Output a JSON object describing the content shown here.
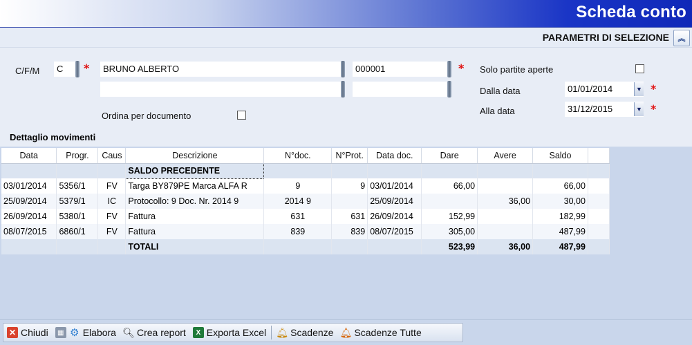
{
  "window": {
    "title": "Scheda conto"
  },
  "params": {
    "header_label": "PARAMETRI DI SELEZIONE",
    "cfm_label": "C/F/M",
    "cfm_value": "C",
    "name_value": "BRUNO ALBERTO",
    "name2_value": "",
    "code_value": "000001",
    "code2_value": "",
    "order_by_doc_label": "Ordina per documento",
    "open_only_label": "Solo partite aperte",
    "from_date_label": "Dalla data",
    "from_date_value": "01/01/2014",
    "to_date_label": "Alla data",
    "to_date_value": "31/12/2015",
    "required_mark": "*"
  },
  "section": {
    "title": "Dettaglio movimenti"
  },
  "grid": {
    "columns": [
      "Data",
      "Progr.",
      "Caus",
      "Descrizione",
      "N°doc.",
      "N°Prot.",
      "Data doc.",
      "Dare",
      "Avere",
      "Saldo"
    ],
    "saldo_precedente": "SALDO PRECEDENTE",
    "rows": [
      {
        "data": "03/01/2014",
        "progr": "5356/1",
        "caus": "FV",
        "descr": "Targa BY879PE Marca ALFA R",
        "ndoc": "9",
        "nprot": "9",
        "datadoc": "03/01/2014",
        "dare": "66,00",
        "avere": "",
        "saldo": "66,00"
      },
      {
        "data": "25/09/2014",
        "progr": "5379/1",
        "caus": "IC",
        "descr": "Protocollo: 9 Doc. Nr. 2014 9",
        "ndoc": "2014 9",
        "nprot": "",
        "datadoc": "25/09/2014",
        "dare": "",
        "avere": "36,00",
        "saldo": "30,00"
      },
      {
        "data": "26/09/2014",
        "progr": "5380/1",
        "caus": "FV",
        "descr": "Fattura",
        "ndoc": "631",
        "nprot": "631",
        "datadoc": "26/09/2014",
        "dare": "152,99",
        "avere": "",
        "saldo": "182,99"
      },
      {
        "data": "08/07/2015",
        "progr": "6860/1",
        "caus": "FV",
        "descr": "Fattura",
        "ndoc": "839",
        "nprot": "839",
        "datadoc": "08/07/2015",
        "dare": "305,00",
        "avere": "",
        "saldo": "487,99"
      }
    ],
    "totals": {
      "label": "TOTALI",
      "dare": "523,99",
      "avere": "36,00",
      "saldo": "487,99"
    }
  },
  "toolbar": {
    "close": "Chiudi",
    "process": "Elabora",
    "report": "Crea report",
    "excel": "Exporta Excel",
    "due": "Scadenze",
    "due_all": "Scadenze Tutte"
  }
}
